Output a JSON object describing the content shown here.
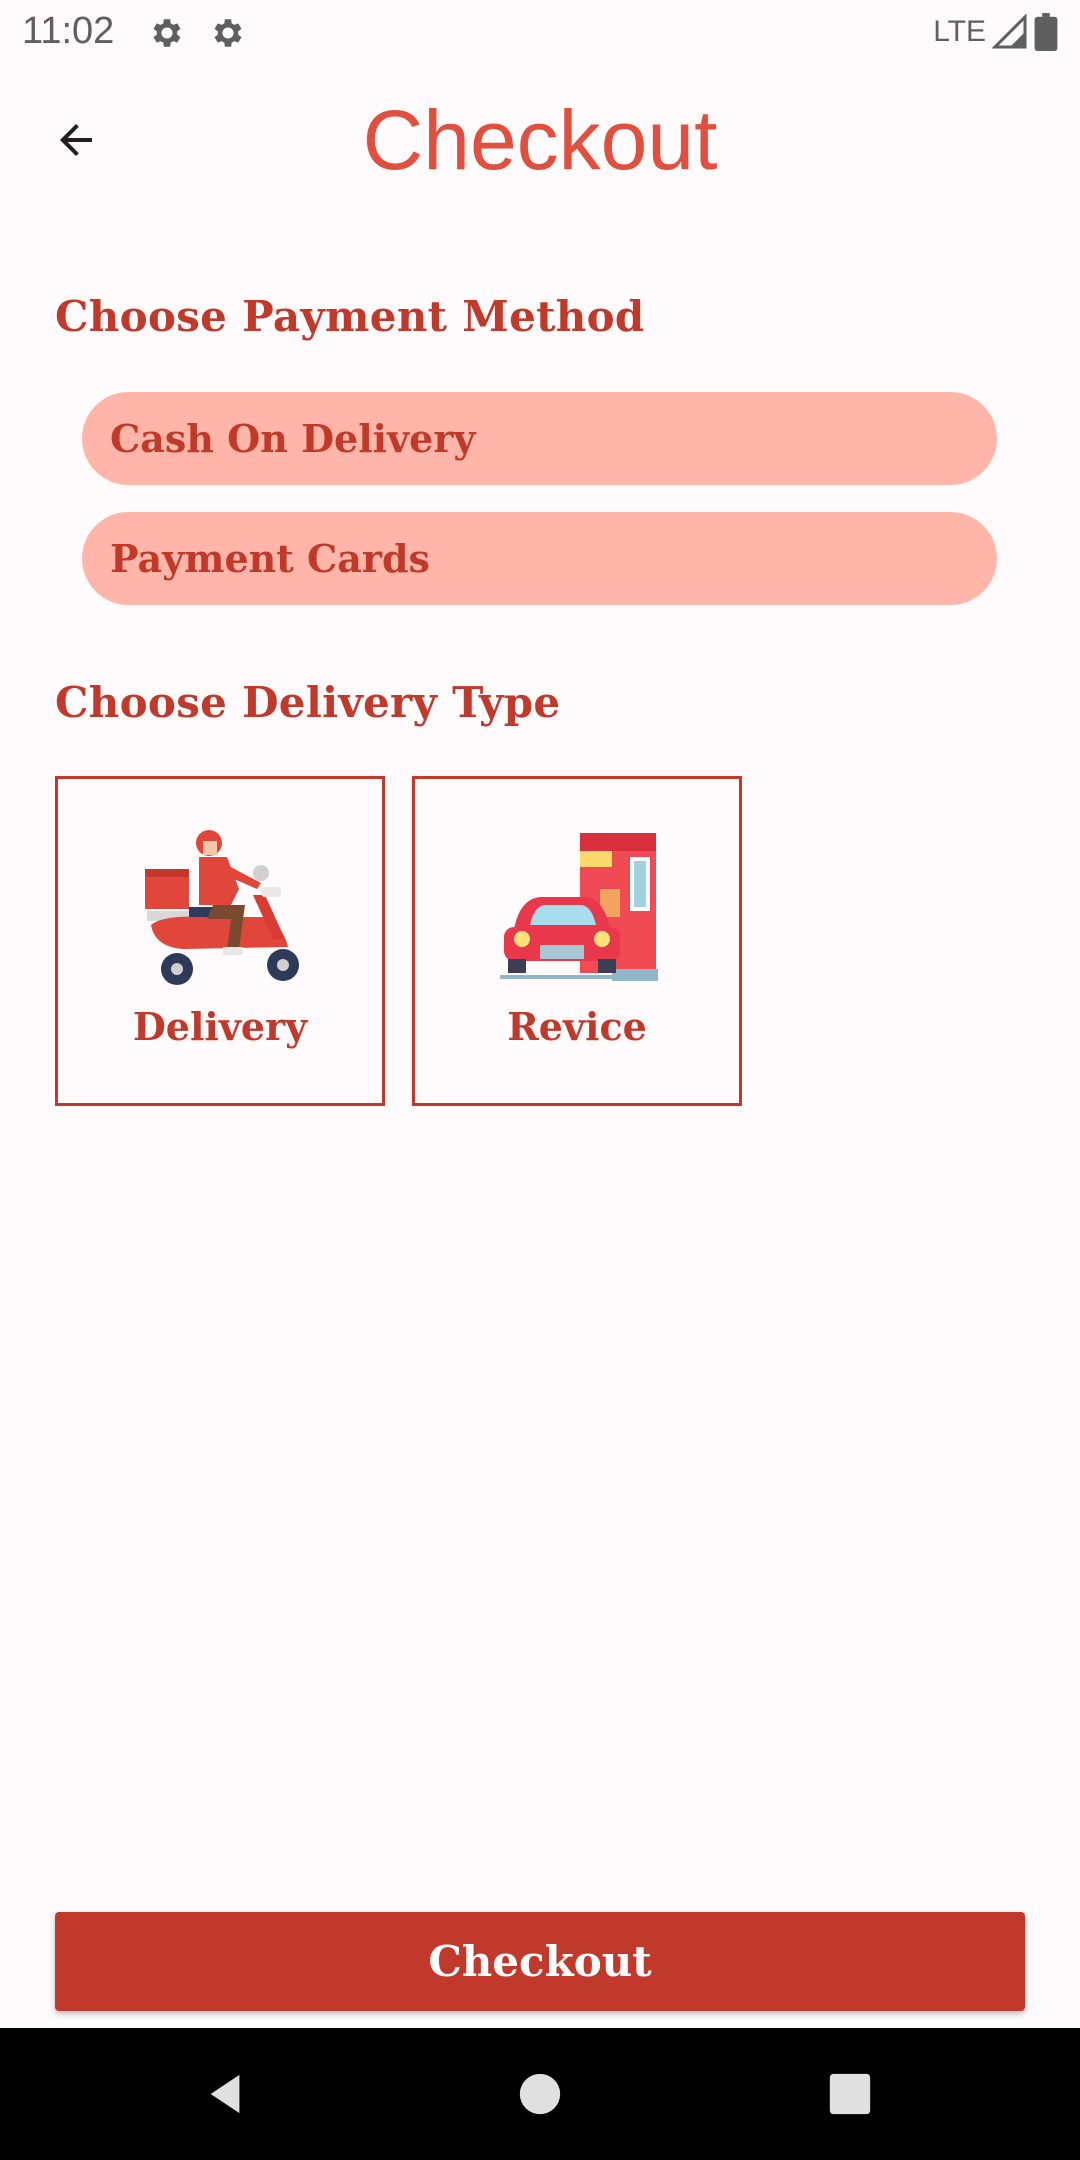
{
  "status_bar": {
    "time": "11:02",
    "network": "LTE",
    "icons": [
      "gear-icon",
      "gear-icon",
      "signal-icon",
      "battery-icon"
    ]
  },
  "header": {
    "title": "Checkout",
    "back_icon": "arrow-left-icon"
  },
  "payment": {
    "heading": "Choose Payment Method",
    "options": [
      {
        "label": "Cash On Delivery"
      },
      {
        "label": "Payment Cards"
      }
    ]
  },
  "delivery": {
    "heading": "Choose Delivery Type",
    "options": [
      {
        "label": "Delivery",
        "icon": "scooter-delivery-icon"
      },
      {
        "label": "Revice",
        "icon": "drive-thru-icon"
      }
    ]
  },
  "checkout_button": {
    "label": "Checkout"
  },
  "nav_bar": {
    "buttons": [
      "back-triangle-icon",
      "home-circle-icon",
      "recents-square-icon"
    ]
  },
  "colors": {
    "accent": "#c0392b",
    "title": "#e14f3f",
    "pill_bg": "#ffb5a7",
    "background": "#fffbfc"
  }
}
